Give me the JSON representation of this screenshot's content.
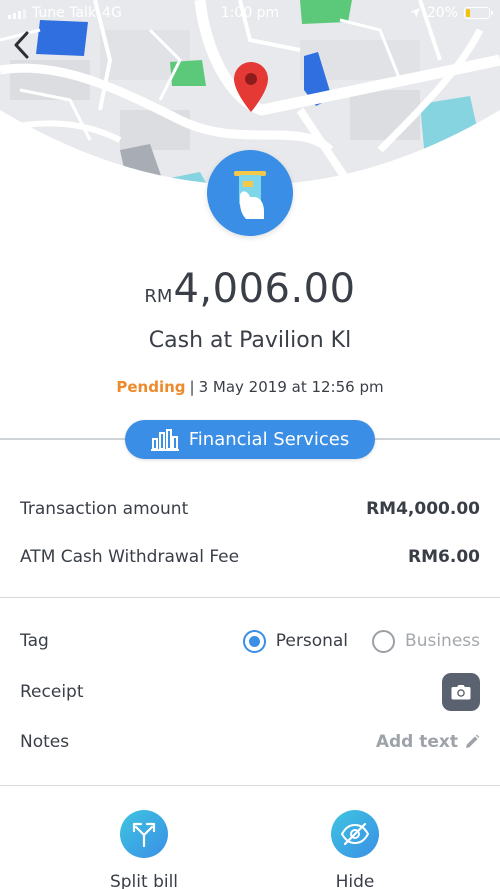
{
  "status_bar": {
    "carrier": "Tune Talk",
    "network": "4G",
    "time": "1:00 pm",
    "battery": "20%",
    "battery_level": 0.2
  },
  "icons": {
    "back": "chevron-left-icon",
    "pin": "map-pin-icon",
    "category": "atm-card-hand-icon",
    "pill": "bar-chart-icon",
    "camera": "camera-icon",
    "pencil": "pencil-icon",
    "split": "split-arrows-icon",
    "hide": "eye-slash-icon"
  },
  "colors": {
    "primary": "#3a8ee6",
    "pending": "#ee8a2b",
    "map_green": "#5cc97a",
    "map_blue": "#2f6fe0",
    "map_teal": "#86d4e0"
  },
  "transaction": {
    "currency": "RM",
    "amount": "4,006.00",
    "merchant": "Cash at Pavilion Kl",
    "status": "Pending",
    "separator": "|",
    "datetime": "3 May 2019 at 12:56 pm",
    "category": "Financial Services"
  },
  "breakdown": [
    {
      "label": "Transaction amount",
      "value": "RM4,000.00"
    },
    {
      "label": "ATM Cash Withdrawal Fee",
      "value": "RM6.00"
    }
  ],
  "details": {
    "tag_label": "Tag",
    "tag_options": [
      "Personal",
      "Business"
    ],
    "tag_selected": "Personal",
    "receipt_label": "Receipt",
    "notes_label": "Notes",
    "notes_placeholder": "Add text"
  },
  "actions": {
    "split": "Split bill",
    "hide": "Hide"
  }
}
